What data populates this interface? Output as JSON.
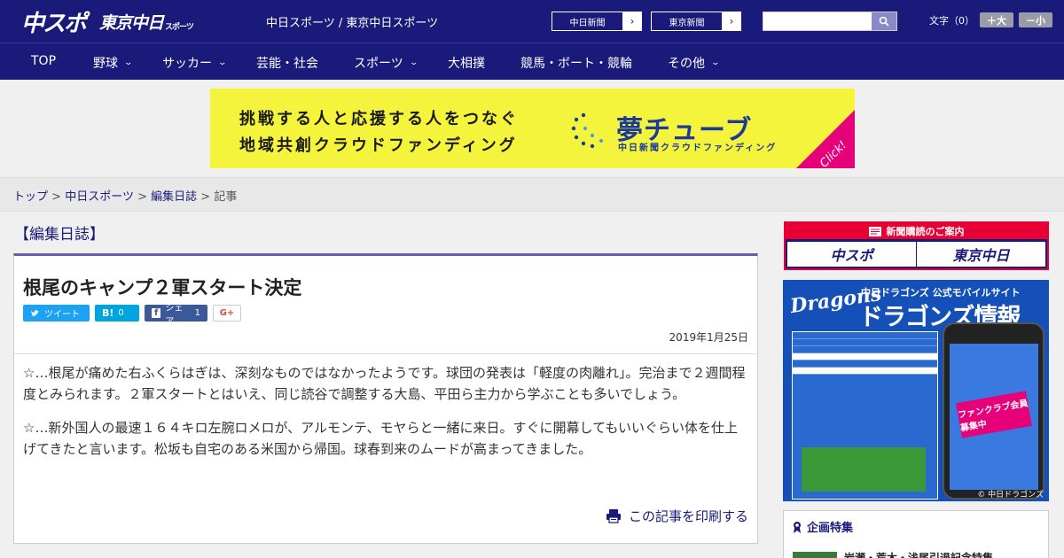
{
  "header": {
    "logo_chuspo": "中スポ",
    "logo_tokyo": "東京中日",
    "logo_small": "スポーツ",
    "site_title": "中日スポーツ / 東京中日スポーツ",
    "ext_links": [
      {
        "label": "中日新聞",
        "arrow": "›"
      },
      {
        "label": "東京新聞",
        "arrow": "›"
      }
    ],
    "search": {
      "value": "",
      "placeholder": ""
    },
    "font_size_label": "文字（0）",
    "font_bigger": "＋大",
    "font_smaller": "－小"
  },
  "nav": {
    "items": [
      {
        "label": "TOP",
        "has_menu": false
      },
      {
        "label": "野球",
        "has_menu": true
      },
      {
        "label": "サッカー",
        "has_menu": true
      },
      {
        "label": "芸能・社会",
        "has_menu": false
      },
      {
        "label": "スポーツ",
        "has_menu": true
      },
      {
        "label": "大相撲",
        "has_menu": false
      },
      {
        "label": "競馬・ボート・競輪",
        "has_menu": false
      },
      {
        "label": "その他",
        "has_menu": true
      }
    ]
  },
  "banner": {
    "line1": "挑戦する人と応援する人をつなぐ",
    "line2": "地域共創クラウドファンディング",
    "brand": "夢チューブ",
    "brand_sub": "中日新聞クラウドファンディング",
    "click": "Click!"
  },
  "breadcrumb": {
    "items": [
      "トップ",
      "中日スポーツ",
      "編集日誌"
    ],
    "separator": ">",
    "current": "記事"
  },
  "section": {
    "heading": "【編集日誌】"
  },
  "article": {
    "title": "根尾のキャンプ２軍スタート決定",
    "share": {
      "tweet": "ツイート",
      "hatena_label": "B!",
      "hatena_count": "0",
      "facebook": "シェア",
      "facebook_count": "1",
      "gplus": "G+"
    },
    "date": "2019年1月25日",
    "paragraphs": [
      "☆…根尾が痛めた右ふくらはぎは、深刻なものではなかったようです。球団の発表は「軽度の肉離れ」。完治まで２週間程度とみられます。２軍スタートとはいえ、同じ読谷で調整する大島、平田ら主力から学ぶことも多いでしょう。",
      "☆…新外国人の最速１６４キロ左腕ロメロが、アルモンテ、モヤらと一緒に来日。すぐに開幕してもいいぐらい体を仕上げてきたと言います。松坂も自宅のある米国から帰国。球春到来のムードが高まってきました。"
    ],
    "print": "この記事を印刷する"
  },
  "sidebar": {
    "subscription": {
      "header": "新聞購読のご案内",
      "logo1": "中スポ",
      "logo2": "東京中日"
    },
    "dragons_ad": {
      "logo": "Dragons",
      "sub": "中日ドラゴンズ 公式モバイルサイト",
      "title": "ドラゴンズ情報",
      "badge": "ファンクラブ会員募集中",
      "copyright": "© 中日ドラゴンズ"
    },
    "special": {
      "title": "企画特集",
      "item": "岩瀬・荒木・浅尾引退記念特集"
    }
  },
  "colors": {
    "header_bg": "#1a1a7a",
    "banner_bg": "#f4f43c",
    "accent_pink": "#e6007a",
    "article_border": "#6a5ab0",
    "subscription_red": "#e60033"
  }
}
